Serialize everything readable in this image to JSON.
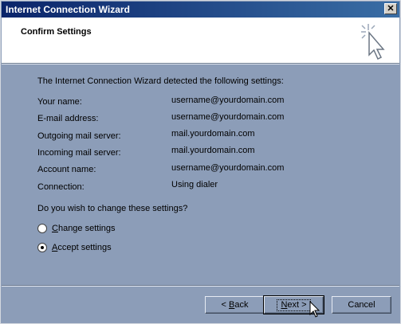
{
  "window": {
    "title": "Internet Connection Wizard",
    "close_glyph": "✕"
  },
  "header": {
    "title": "Confirm Settings",
    "icon": "wizard-cursor-sparkle-icon"
  },
  "body": {
    "intro": "The Internet Connection Wizard detected the following settings:",
    "settings": [
      {
        "label": "Your name:",
        "value": "username@yourdomain.com"
      },
      {
        "label": "E-mail address:",
        "value": "username@yourdomain.com"
      },
      {
        "label": "Outgoing mail server:",
        "value": "mail.yourdomain.com"
      },
      {
        "label": "Incoming mail server:",
        "value": "mail.yourdomain.com"
      },
      {
        "label": "Account name:",
        "value": "username@yourdomain.com"
      },
      {
        "label": "Connection:",
        "value": "Using dialer"
      }
    ],
    "question": "Do you wish to change these settings?",
    "options": [
      {
        "accel": "C",
        "rest": "hange settings",
        "selected": false
      },
      {
        "accel": "A",
        "rest": "ccept settings",
        "selected": true
      }
    ]
  },
  "buttons": {
    "back": {
      "prefix": "< ",
      "accel": "B",
      "rest": "ack"
    },
    "next": {
      "accel": "N",
      "rest": "ext >"
    },
    "cancel": {
      "label": "Cancel"
    }
  },
  "colors": {
    "dialog_bg": "#8c9db8",
    "title_bar": "#0a246a",
    "header_bg": "#ffffff"
  }
}
